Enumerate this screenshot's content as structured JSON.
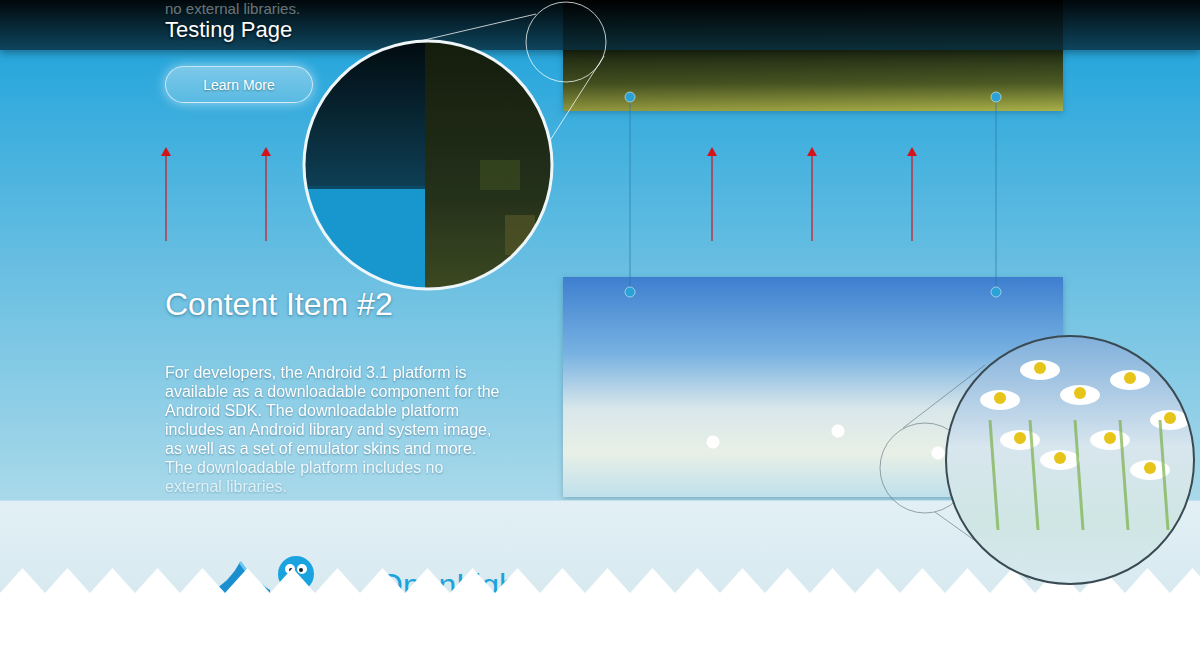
{
  "page": {
    "title": "Testing Page",
    "ghost_text": "no external libraries."
  },
  "hero": {
    "button": "Learn More"
  },
  "content": {
    "heading": "Content Item #2",
    "body": "For developers, the Android 3.1 platform is available as a downloadable component for the Android SDK. The downloadable platform includes an Android library and system image, as well as a set of emulator skins and more. The downloadable platform includes no external libraries."
  },
  "footer": {
    "brand": "OpenLight"
  }
}
